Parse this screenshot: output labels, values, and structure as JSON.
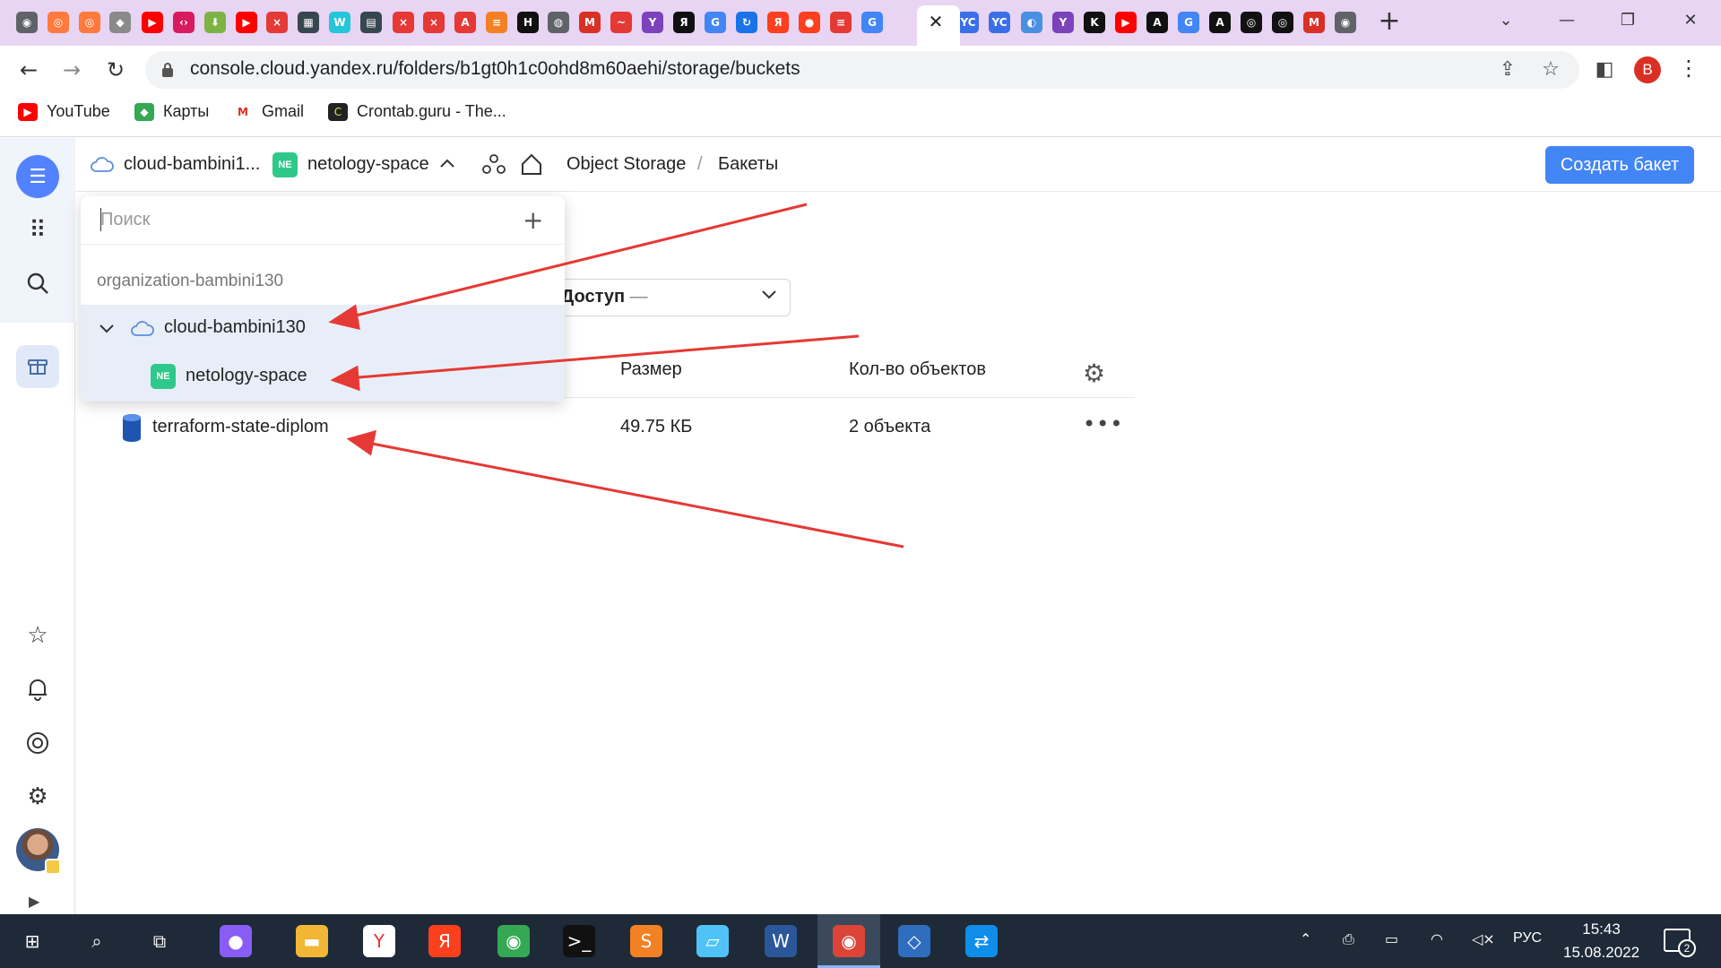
{
  "browser": {
    "url": "console.cloud.yandex.ru/folders/b1gt0h1c0ohd8m60aehi/storage/buckets",
    "bookmarks": [
      {
        "label": "YouTube",
        "icon": "youtube-icon"
      },
      {
        "label": "Карты",
        "icon": "maps-icon"
      },
      {
        "label": "Gmail",
        "icon": "gmail-icon"
      },
      {
        "label": "Crontab.guru - The...",
        "icon": "crontab-icon"
      }
    ],
    "profile_letter": "B",
    "tab_close": "✕",
    "new_tab": "+"
  },
  "header": {
    "cloud_name": "cloud-bambini1...",
    "folder_badge": "NE",
    "folder_name": "netology-space",
    "service": "Object Storage",
    "separator": "/",
    "page": "Бакеты",
    "create_button": "Создать бакет"
  },
  "filter": {
    "label": "Доступ",
    "value": "—"
  },
  "table": {
    "columns": {
      "size": "Размер",
      "count": "Кол-во объектов"
    },
    "rows": [
      {
        "name": "terraform-state-diplom",
        "size": "49.75 КБ",
        "count": "2 объекта"
      }
    ]
  },
  "dropdown": {
    "search_placeholder": "Поиск",
    "organization": "organization-bambini130",
    "cloud": "cloud-bambini130",
    "folder_badge": "NE",
    "folder": "netology-space"
  },
  "taskbar": {
    "language": "РУС",
    "time": "15:43",
    "date": "15.08.2022",
    "notifications": "2"
  },
  "colors": {
    "accent": "#4285f4",
    "tabstrip": "#e8d4f3",
    "folder_badge": "#2ec98a",
    "annotation_arrow": "#e53935",
    "taskbar": "#1e2a38"
  }
}
